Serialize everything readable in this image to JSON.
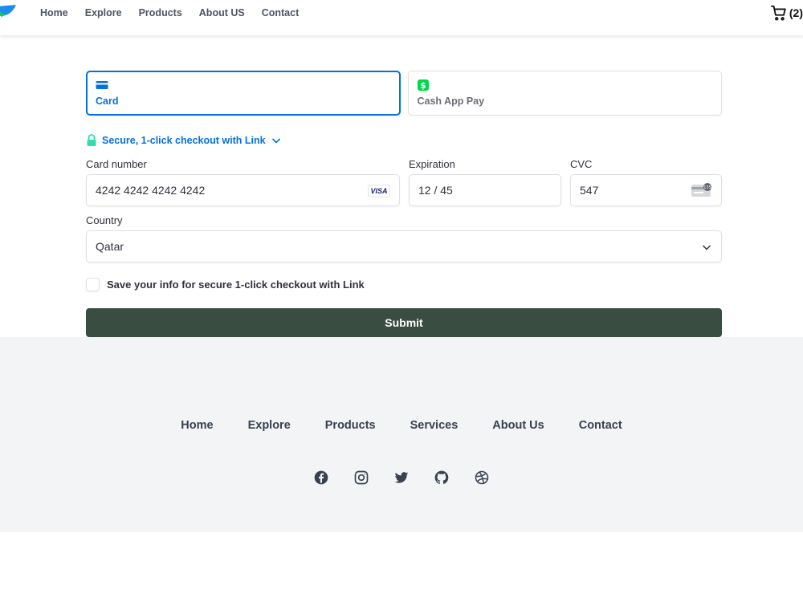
{
  "header": {
    "nav": [
      "Home",
      "Explore",
      "Products",
      "About US",
      "Contact"
    ],
    "cart_count": "(2)"
  },
  "payment": {
    "tabs": [
      {
        "label": "Card",
        "icon": "credit-card-icon",
        "active": true
      },
      {
        "label": "Cash App Pay",
        "icon": "cash-app-icon",
        "active": false
      }
    ],
    "link_text": "Secure, 1-click checkout with Link",
    "card_number": {
      "label": "Card number",
      "value": "4242 4242 4242 4242",
      "brand": "VISA"
    },
    "expiration": {
      "label": "Expiration",
      "value": "12 / 45"
    },
    "cvc": {
      "label": "CVC",
      "value": "547",
      "badge": "135"
    },
    "country": {
      "label": "Country",
      "value": "Qatar"
    },
    "save_info": "Save your info for secure 1-click checkout with Link",
    "submit_label": "Submit"
  },
  "footer": {
    "nav": [
      "Home",
      "Explore",
      "Products",
      "Services",
      "About Us",
      "Contact"
    ],
    "social": [
      "facebook-icon",
      "instagram-icon",
      "twitter-icon",
      "github-icon",
      "dribbble-icon"
    ]
  },
  "colors": {
    "accent": "#0570de",
    "submit_bg": "#3a4d41",
    "footer_bg": "#f3f4f6",
    "cash_app": "#00d54b",
    "lock": "#33ddb3"
  }
}
